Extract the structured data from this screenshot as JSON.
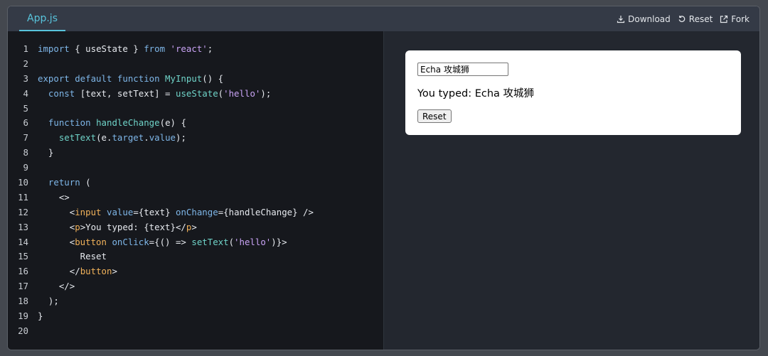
{
  "tabs": [
    {
      "label": "App.js"
    }
  ],
  "toolbar": {
    "download_label": "Download",
    "reset_label": "Reset",
    "fork_label": "Fork"
  },
  "editor": {
    "lines": [
      {
        "num": "1",
        "tokens": [
          {
            "c": "kw",
            "t": "import"
          },
          {
            "c": "src",
            "t": " { useState } "
          },
          {
            "c": "kw",
            "t": "from"
          },
          {
            "c": "src",
            "t": " "
          },
          {
            "c": "str",
            "t": "'react'"
          },
          {
            "c": "src",
            "t": ";"
          }
        ]
      },
      {
        "num": "2",
        "tokens": []
      },
      {
        "num": "3",
        "tokens": [
          {
            "c": "kw",
            "t": "export default function"
          },
          {
            "c": "src",
            "t": " "
          },
          {
            "c": "fn",
            "t": "MyInput"
          },
          {
            "c": "src",
            "t": "() {"
          }
        ]
      },
      {
        "num": "4",
        "tokens": [
          {
            "c": "src",
            "t": "  "
          },
          {
            "c": "kw",
            "t": "const"
          },
          {
            "c": "src",
            "t": " [text, setText] = "
          },
          {
            "c": "fn",
            "t": "useState"
          },
          {
            "c": "src",
            "t": "("
          },
          {
            "c": "str",
            "t": "'hello'"
          },
          {
            "c": "src",
            "t": ");"
          }
        ]
      },
      {
        "num": "5",
        "tokens": []
      },
      {
        "num": "6",
        "tokens": [
          {
            "c": "src",
            "t": "  "
          },
          {
            "c": "kw",
            "t": "function"
          },
          {
            "c": "src",
            "t": " "
          },
          {
            "c": "fn",
            "t": "handleChange"
          },
          {
            "c": "src",
            "t": "(e) {"
          }
        ]
      },
      {
        "num": "7",
        "tokens": [
          {
            "c": "src",
            "t": "    "
          },
          {
            "c": "fn",
            "t": "setText"
          },
          {
            "c": "src",
            "t": "(e."
          },
          {
            "c": "attr",
            "t": "target"
          },
          {
            "c": "src",
            "t": "."
          },
          {
            "c": "attr",
            "t": "value"
          },
          {
            "c": "src",
            "t": ");"
          }
        ]
      },
      {
        "num": "8",
        "tokens": [
          {
            "c": "src",
            "t": "  }"
          }
        ]
      },
      {
        "num": "9",
        "tokens": []
      },
      {
        "num": "10",
        "tokens": [
          {
            "c": "src",
            "t": "  "
          },
          {
            "c": "kw",
            "t": "return"
          },
          {
            "c": "src",
            "t": " ("
          }
        ]
      },
      {
        "num": "11",
        "tokens": [
          {
            "c": "src",
            "t": "    <>"
          }
        ]
      },
      {
        "num": "12",
        "tokens": [
          {
            "c": "src",
            "t": "      <"
          },
          {
            "c": "tag",
            "t": "input"
          },
          {
            "c": "src",
            "t": " "
          },
          {
            "c": "attr",
            "t": "value"
          },
          {
            "c": "src",
            "t": "={text} "
          },
          {
            "c": "attr",
            "t": "onChange"
          },
          {
            "c": "src",
            "t": "={handleChange} />"
          }
        ]
      },
      {
        "num": "13",
        "tokens": [
          {
            "c": "src",
            "t": "      <"
          },
          {
            "c": "tag",
            "t": "p"
          },
          {
            "c": "src",
            "t": ">You typed: {text}</"
          },
          {
            "c": "tag",
            "t": "p"
          },
          {
            "c": "src",
            "t": ">"
          }
        ]
      },
      {
        "num": "14",
        "tokens": [
          {
            "c": "src",
            "t": "      <"
          },
          {
            "c": "tag",
            "t": "button"
          },
          {
            "c": "src",
            "t": " "
          },
          {
            "c": "attr",
            "t": "onClick"
          },
          {
            "c": "src",
            "t": "={() => "
          },
          {
            "c": "fn",
            "t": "setText"
          },
          {
            "c": "src",
            "t": "("
          },
          {
            "c": "str",
            "t": "'hello'"
          },
          {
            "c": "src",
            "t": ")}>"
          }
        ]
      },
      {
        "num": "15",
        "tokens": [
          {
            "c": "src",
            "t": "        Reset"
          }
        ]
      },
      {
        "num": "16",
        "tokens": [
          {
            "c": "src",
            "t": "      </"
          },
          {
            "c": "tag",
            "t": "button"
          },
          {
            "c": "src",
            "t": ">"
          }
        ]
      },
      {
        "num": "17",
        "tokens": [
          {
            "c": "src",
            "t": "    </>"
          }
        ]
      },
      {
        "num": "18",
        "tokens": [
          {
            "c": "src",
            "t": "  );"
          }
        ]
      },
      {
        "num": "19",
        "tokens": [
          {
            "c": "src",
            "t": "}"
          }
        ]
      },
      {
        "num": "20",
        "tokens": []
      }
    ]
  },
  "preview": {
    "input_value": "Echa 攻城狮",
    "typed_text": "You typed: Echa 攻城狮",
    "reset_button_label": "Reset"
  },
  "colors": {
    "accent": "#58c4dc",
    "editor_bg": "#16181d",
    "preview_bg": "#23272f",
    "toolbar_bg": "#343a46"
  },
  "icons": {
    "download": "download-icon",
    "reset": "reset-icon",
    "fork": "external-link-icon"
  }
}
